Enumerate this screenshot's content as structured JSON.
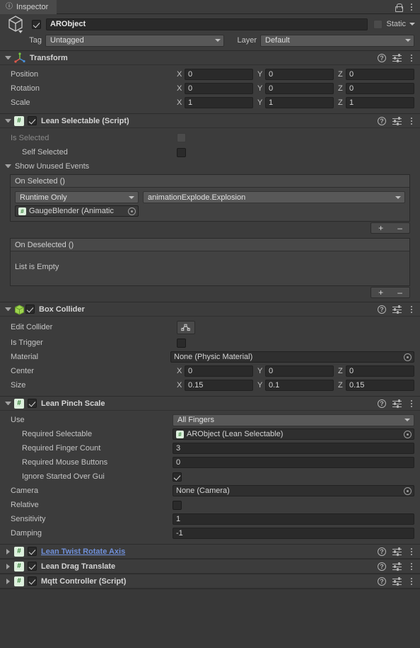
{
  "window": {
    "tab_label": "Inspector",
    "tab_icon": "info-icon",
    "lock_icon": "lock-icon",
    "menu_icon": "kebab-menu-icon"
  },
  "object_header": {
    "enabled": true,
    "name": "ARObject",
    "static_label": "Static",
    "static_checked": false,
    "tag_label": "Tag",
    "tag_value": "Untagged",
    "layer_label": "Layer",
    "layer_value": "Default"
  },
  "components": [
    {
      "id": "transform",
      "title": "Transform",
      "icon": "transform-axis-icon",
      "expanded": true,
      "has_checkbox": false,
      "rows": [
        {
          "label": "Position",
          "type": "vector3",
          "x": "0",
          "y": "0",
          "z": "0"
        },
        {
          "label": "Rotation",
          "type": "vector3",
          "x": "0",
          "y": "0",
          "z": "0"
        },
        {
          "label": "Scale",
          "type": "vector3",
          "x": "1",
          "y": "1",
          "z": "1"
        }
      ]
    },
    {
      "id": "lean-selectable",
      "title": "Lean Selectable (Script)",
      "icon": "script-icon",
      "expanded": true,
      "has_checkbox": true,
      "enabled": true,
      "rows": [
        {
          "label": "Is Selected",
          "type": "checkbox",
          "checked": false,
          "disabled": true
        },
        {
          "label": "Self Selected",
          "type": "checkbox",
          "checked": false,
          "indent": 1
        }
      ],
      "show_unused_events_label": "Show Unused Events",
      "events": [
        {
          "title": "On Selected ()",
          "empty": false,
          "entries": [
            {
              "mode": "Runtime Only",
              "method": "animationExplode.Explosion",
              "target": "GaugeBlender (Animatic"
            }
          ],
          "add_label": "+",
          "remove_label": "–"
        },
        {
          "title": "On Deselected ()",
          "empty": true,
          "empty_label": "List is Empty",
          "entries": [],
          "add_label": "+",
          "remove_label": "–"
        }
      ]
    },
    {
      "id": "box-collider",
      "title": "Box Collider",
      "icon": "box-collider-icon",
      "expanded": true,
      "has_checkbox": true,
      "enabled": true,
      "rows": [
        {
          "label": "Edit Collider",
          "type": "button",
          "button_icon": "edit-collider-icon"
        },
        {
          "label": "Is Trigger",
          "type": "checkbox",
          "checked": false
        },
        {
          "label": "Material",
          "type": "object",
          "value": "None (Physic Material)",
          "has_icon": false
        },
        {
          "label": "Center",
          "type": "vector3",
          "x": "0",
          "y": "0",
          "z": "0"
        },
        {
          "label": "Size",
          "type": "vector3",
          "x": "0.15",
          "y": "0.1",
          "z": "0.15"
        }
      ]
    },
    {
      "id": "lean-pinch-scale",
      "title": "Lean Pinch Scale",
      "icon": "script-icon",
      "expanded": true,
      "has_checkbox": true,
      "enabled": true,
      "rows": [
        {
          "label": "Use",
          "type": "popup",
          "value": "All Fingers"
        },
        {
          "label": "Required Selectable",
          "type": "object",
          "value": "ARObject (Lean Selectable)",
          "has_icon": true,
          "indent": 1
        },
        {
          "label": "Required Finger Count",
          "type": "text",
          "value": "3",
          "indent": 1
        },
        {
          "label": "Required Mouse Buttons",
          "type": "text",
          "value": "0",
          "indent": 1
        },
        {
          "label": "Ignore Started Over Gui",
          "type": "checkbox",
          "checked": true,
          "indent": 1
        },
        {
          "label": "Camera",
          "type": "object",
          "value": "None (Camera)",
          "has_icon": false
        },
        {
          "label": "Relative",
          "type": "checkbox",
          "checked": false
        },
        {
          "label": "Sensitivity",
          "type": "text",
          "value": "1"
        },
        {
          "label": "Damping",
          "type": "text",
          "value": "-1"
        }
      ]
    }
  ],
  "collapsed_components": [
    {
      "id": "lean-twist-rotate-axis",
      "title": "Lean Twist Rotate Axis",
      "icon": "script-icon",
      "enabled": true,
      "is_link": true
    },
    {
      "id": "lean-drag-translate",
      "title": "Lean Drag Translate",
      "icon": "script-icon",
      "enabled": true,
      "is_link": false
    },
    {
      "id": "mqtt-controller",
      "title": "Mqtt Controller (Script)",
      "icon": "script-icon",
      "enabled": true,
      "is_link": false
    }
  ],
  "header_icons": {
    "help": "help-icon",
    "preset": "preset-settings-icon",
    "menu": "kebab-menu-icon"
  },
  "colors": {
    "panel": "#383838",
    "section": "#3c3c3c",
    "field": "#2a2a2a",
    "popup": "#585858",
    "link": "#6f8fd8",
    "script_icon": "#ddf0dd",
    "collider_icon": "#9ed44f"
  }
}
